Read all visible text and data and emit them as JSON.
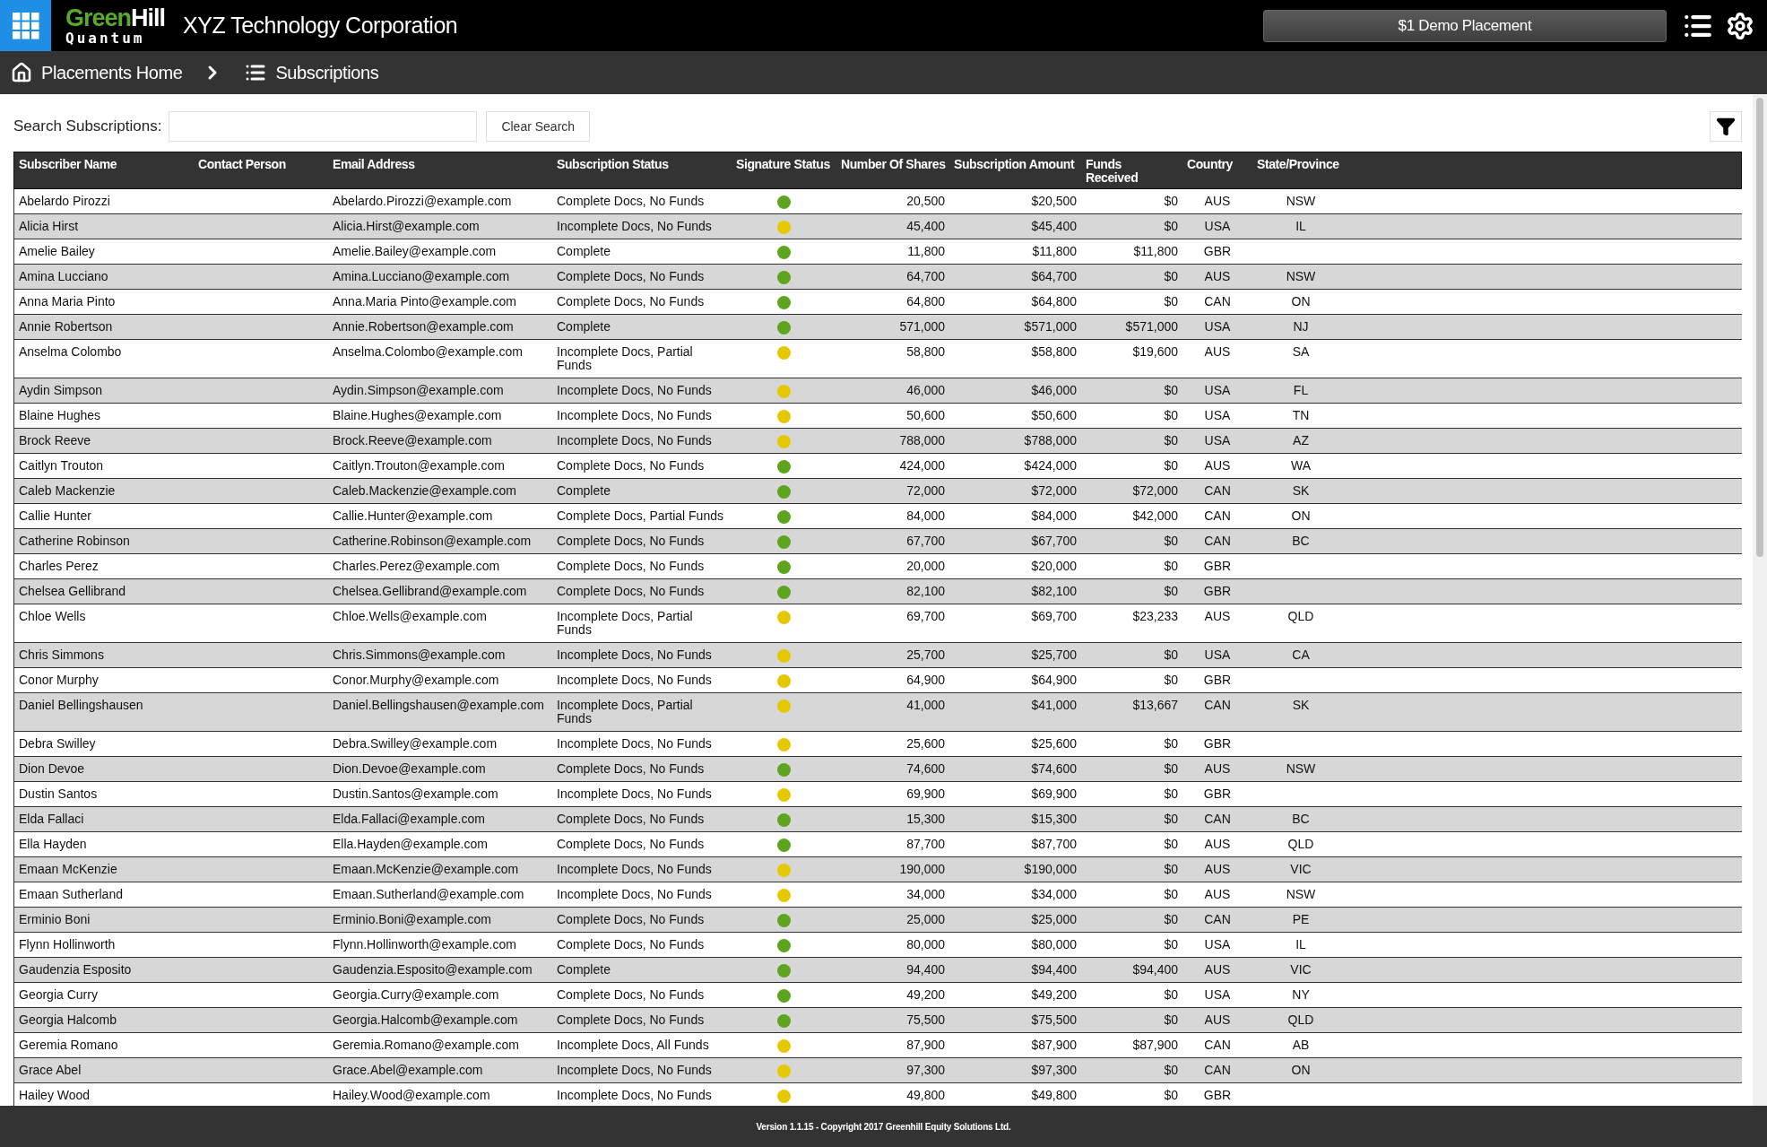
{
  "header": {
    "brand_first": "Green",
    "brand_second": "Hill",
    "brand_sub": "Quantum",
    "company": "XYZ Technology Corporation",
    "placement_button": "$1 Demo Placement"
  },
  "breadcrumbs": [
    {
      "label": "Placements Home",
      "kind": "home"
    },
    {
      "label": "Subscriptions",
      "kind": "list"
    }
  ],
  "search": {
    "label": "Search Subscriptions:",
    "button": "Clear Search"
  },
  "table": {
    "columns": [
      "Subscriber Name",
      "Contact Person",
      "Email Address",
      "Subscription Status",
      "Signature Status",
      "Number Of Shares",
      "Subscription Amount",
      "Funds Received",
      "Country",
      "State/Province"
    ],
    "rows": [
      {
        "name": "Abelardo Pirozzi",
        "email": "Abelardo.Pirozzi@example.com",
        "status": "Complete Docs, No Funds",
        "color": "#5ea41e",
        "shares": "20,500",
        "amount": "$20,500",
        "funds": "$0",
        "country": "AUS",
        "state": "NSW"
      },
      {
        "name": "Alicia Hirst",
        "email": "Alicia.Hirst@example.com",
        "status": "Incomplete Docs, No Funds",
        "color": "#e6c800",
        "shares": "45,400",
        "amount": "$45,400",
        "funds": "$0",
        "country": "USA",
        "state": "IL"
      },
      {
        "name": "Amelie Bailey",
        "email": "Amelie.Bailey@example.com",
        "status": "Complete",
        "color": "#5ea41e",
        "shares": "11,800",
        "amount": "$11,800",
        "funds": "$11,800",
        "country": "GBR",
        "state": ""
      },
      {
        "name": "Amina Lucciano",
        "email": "Amina.Lucciano@example.com",
        "status": "Complete Docs, No Funds",
        "color": "#5ea41e",
        "shares": "64,700",
        "amount": "$64,700",
        "funds": "$0",
        "country": "AUS",
        "state": "NSW"
      },
      {
        "name": "Anna Maria Pinto",
        "email": "Anna.Maria Pinto@example.com",
        "status": "Complete Docs, No Funds",
        "color": "#5ea41e",
        "shares": "64,800",
        "amount": "$64,800",
        "funds": "$0",
        "country": "CAN",
        "state": "ON"
      },
      {
        "name": "Annie Robertson",
        "email": "Annie.Robertson@example.com",
        "status": "Complete",
        "color": "#5ea41e",
        "shares": "571,000",
        "amount": "$571,000",
        "funds": "$571,000",
        "country": "USA",
        "state": "NJ"
      },
      {
        "name": "Anselma Colombo",
        "email": "Anselma.Colombo@example.com",
        "status": "Incomplete Docs, Partial Funds",
        "color": "#e6c800",
        "shares": "58,800",
        "amount": "$58,800",
        "funds": "$19,600",
        "country": "AUS",
        "state": "SA"
      },
      {
        "name": "Aydin Simpson",
        "email": "Aydin.Simpson@example.com",
        "status": "Incomplete Docs, No Funds",
        "color": "#e6c800",
        "shares": "46,000",
        "amount": "$46,000",
        "funds": "$0",
        "country": "USA",
        "state": "FL"
      },
      {
        "name": "Blaine Hughes",
        "email": "Blaine.Hughes@example.com",
        "status": "Incomplete Docs, No Funds",
        "color": "#e6c800",
        "shares": "50,600",
        "amount": "$50,600",
        "funds": "$0",
        "country": "USA",
        "state": "TN"
      },
      {
        "name": "Brock Reeve",
        "email": "Brock.Reeve@example.com",
        "status": "Incomplete Docs, No Funds",
        "color": "#e6c800",
        "shares": "788,000",
        "amount": "$788,000",
        "funds": "$0",
        "country": "USA",
        "state": "AZ"
      },
      {
        "name": "Caitlyn Trouton",
        "email": "Caitlyn.Trouton@example.com",
        "status": "Complete Docs, No Funds",
        "color": "#5ea41e",
        "shares": "424,000",
        "amount": "$424,000",
        "funds": "$0",
        "country": "AUS",
        "state": "WA"
      },
      {
        "name": "Caleb Mackenzie",
        "email": "Caleb.Mackenzie@example.com",
        "status": "Complete",
        "color": "#5ea41e",
        "shares": "72,000",
        "amount": "$72,000",
        "funds": "$72,000",
        "country": "CAN",
        "state": "SK"
      },
      {
        "name": "Callie Hunter",
        "email": "Callie.Hunter@example.com",
        "status": "Complete Docs, Partial Funds",
        "color": "#5ea41e",
        "shares": "84,000",
        "amount": "$84,000",
        "funds": "$42,000",
        "country": "CAN",
        "state": "ON"
      },
      {
        "name": "Catherine Robinson",
        "email": "Catherine.Robinson@example.com",
        "status": "Complete Docs, No Funds",
        "color": "#5ea41e",
        "shares": "67,700",
        "amount": "$67,700",
        "funds": "$0",
        "country": "CAN",
        "state": "BC"
      },
      {
        "name": "Charles Perez",
        "email": "Charles.Perez@example.com",
        "status": "Complete Docs, No Funds",
        "color": "#5ea41e",
        "shares": "20,000",
        "amount": "$20,000",
        "funds": "$0",
        "country": "GBR",
        "state": ""
      },
      {
        "name": "Chelsea Gellibrand",
        "email": "Chelsea.Gellibrand@example.com",
        "status": "Complete Docs, No Funds",
        "color": "#5ea41e",
        "shares": "82,100",
        "amount": "$82,100",
        "funds": "$0",
        "country": "GBR",
        "state": ""
      },
      {
        "name": "Chloe Wells",
        "email": "Chloe.Wells@example.com",
        "status": "Incomplete Docs, Partial Funds",
        "color": "#e6c800",
        "shares": "69,700",
        "amount": "$69,700",
        "funds": "$23,233",
        "country": "AUS",
        "state": "QLD"
      },
      {
        "name": "Chris Simmons",
        "email": "Chris.Simmons@example.com",
        "status": "Incomplete Docs, No Funds",
        "color": "#e6c800",
        "shares": "25,700",
        "amount": "$25,700",
        "funds": "$0",
        "country": "USA",
        "state": "CA"
      },
      {
        "name": "Conor Murphy",
        "email": "Conor.Murphy@example.com",
        "status": "Incomplete Docs, No Funds",
        "color": "#e6c800",
        "shares": "64,900",
        "amount": "$64,900",
        "funds": "$0",
        "country": "GBR",
        "state": ""
      },
      {
        "name": "Daniel Bellingshausen",
        "email": "Daniel.Bellingshausen@example.com",
        "status": "Incomplete Docs, Partial Funds",
        "color": "#e6c800",
        "shares": "41,000",
        "amount": "$41,000",
        "funds": "$13,667",
        "country": "CAN",
        "state": "SK"
      },
      {
        "name": "Debra Swilley",
        "email": "Debra.Swilley@example.com",
        "status": "Incomplete Docs, No Funds",
        "color": "#e6c800",
        "shares": "25,600",
        "amount": "$25,600",
        "funds": "$0",
        "country": "GBR",
        "state": ""
      },
      {
        "name": "Dion Devoe",
        "email": "Dion.Devoe@example.com",
        "status": "Complete Docs, No Funds",
        "color": "#5ea41e",
        "shares": "74,600",
        "amount": "$74,600",
        "funds": "$0",
        "country": "AUS",
        "state": "NSW"
      },
      {
        "name": "Dustin Santos",
        "email": "Dustin.Santos@example.com",
        "status": "Incomplete Docs, No Funds",
        "color": "#e6c800",
        "shares": "69,900",
        "amount": "$69,900",
        "funds": "$0",
        "country": "GBR",
        "state": ""
      },
      {
        "name": "Elda Fallaci",
        "email": "Elda.Fallaci@example.com",
        "status": "Complete Docs, No Funds",
        "color": "#5ea41e",
        "shares": "15,300",
        "amount": "$15,300",
        "funds": "$0",
        "country": "CAN",
        "state": "BC"
      },
      {
        "name": "Ella Hayden",
        "email": "Ella.Hayden@example.com",
        "status": "Complete Docs, No Funds",
        "color": "#5ea41e",
        "shares": "87,700",
        "amount": "$87,700",
        "funds": "$0",
        "country": "AUS",
        "state": "QLD"
      },
      {
        "name": "Emaan McKenzie",
        "email": "Emaan.McKenzie@example.com",
        "status": "Incomplete Docs, No Funds",
        "color": "#e6c800",
        "shares": "190,000",
        "amount": "$190,000",
        "funds": "$0",
        "country": "AUS",
        "state": "VIC"
      },
      {
        "name": "Emaan Sutherland",
        "email": "Emaan.Sutherland@example.com",
        "status": "Incomplete Docs, No Funds",
        "color": "#e6c800",
        "shares": "34,000",
        "amount": "$34,000",
        "funds": "$0",
        "country": "AUS",
        "state": "NSW"
      },
      {
        "name": "Erminio Boni",
        "email": "Erminio.Boni@example.com",
        "status": "Complete Docs, No Funds",
        "color": "#5ea41e",
        "shares": "25,000",
        "amount": "$25,000",
        "funds": "$0",
        "country": "CAN",
        "state": "PE"
      },
      {
        "name": "Flynn Hollinworth",
        "email": "Flynn.Hollinworth@example.com",
        "status": "Complete Docs, No Funds",
        "color": "#5ea41e",
        "shares": "80,000",
        "amount": "$80,000",
        "funds": "$0",
        "country": "USA",
        "state": "IL"
      },
      {
        "name": "Gaudenzia Esposito",
        "email": "Gaudenzia.Esposito@example.com",
        "status": "Complete",
        "color": "#5ea41e",
        "shares": "94,400",
        "amount": "$94,400",
        "funds": "$94,400",
        "country": "AUS",
        "state": "VIC"
      },
      {
        "name": "Georgia Curry",
        "email": "Georgia.Curry@example.com",
        "status": "Complete Docs, No Funds",
        "color": "#5ea41e",
        "shares": "49,200",
        "amount": "$49,200",
        "funds": "$0",
        "country": "USA",
        "state": "NY"
      },
      {
        "name": "Georgia Halcomb",
        "email": "Georgia.Halcomb@example.com",
        "status": "Complete Docs, No Funds",
        "color": "#5ea41e",
        "shares": "75,500",
        "amount": "$75,500",
        "funds": "$0",
        "country": "AUS",
        "state": "QLD"
      },
      {
        "name": "Geremia Romano",
        "email": "Geremia.Romano@example.com",
        "status": "Incomplete Docs, All Funds",
        "color": "#e6c800",
        "shares": "87,900",
        "amount": "$87,900",
        "funds": "$87,900",
        "country": "CAN",
        "state": "AB"
      },
      {
        "name": "Grace Abel",
        "email": "Grace.Abel@example.com",
        "status": "Incomplete Docs, No Funds",
        "color": "#e6c800",
        "shares": "97,300",
        "amount": "$97,300",
        "funds": "$0",
        "country": "CAN",
        "state": "ON"
      },
      {
        "name": "Hailey Wood",
        "email": "Hailey.Wood@example.com",
        "status": "Incomplete Docs, No Funds",
        "color": "#e6c800",
        "shares": "49,800",
        "amount": "$49,800",
        "funds": "$0",
        "country": "GBR",
        "state": ""
      }
    ]
  },
  "footer": "Version 1.1.15 - Copyright 2017 Greenhill Equity Solutions Ltd."
}
